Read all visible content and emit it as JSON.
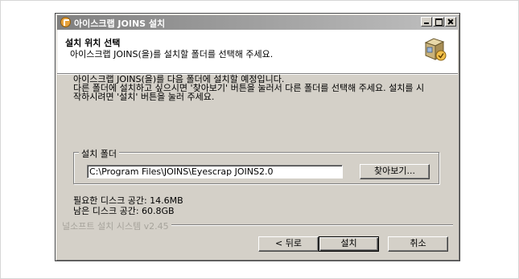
{
  "window": {
    "title": "아이스크랩 JOINS 설치",
    "controls": {
      "minimize": "minimize",
      "maximize": "maximize",
      "close": "close"
    }
  },
  "header": {
    "title": "설치 위치 선택",
    "subtitle": "아이스크랩 JOINS(을)를 설치할 폴더를 선택해 주세요."
  },
  "body": {
    "line1": "아이스크랩 JOINS(을)를 다음 폴더에 설치할 예정입니다.",
    "line2": "다른 폴더에 설치하고 싶으시면 '찾아보기' 버튼을 눌러서 다른 폴더를 선택해 주세요. 설치를 시",
    "line3": "작하시려면 '설치' 버튼을 눌러 주세요."
  },
  "install_folder": {
    "label": "설치 폴더",
    "path": "C:\\Program Files\\JOINS\\Eyescrap JOINS2.0",
    "browse_label": "찾아보기..."
  },
  "disk": {
    "required": "필요한 디스크 공간: 14.6MB",
    "available": "남은 디스크 공간: 60.8GB"
  },
  "branding": "널소프트 설치 시스템 v2.45",
  "buttons": {
    "back": "< 뒤로",
    "install": "설치",
    "cancel": "취소"
  },
  "icons": {
    "app": "app-icon",
    "installer": "installer-box-icon"
  }
}
